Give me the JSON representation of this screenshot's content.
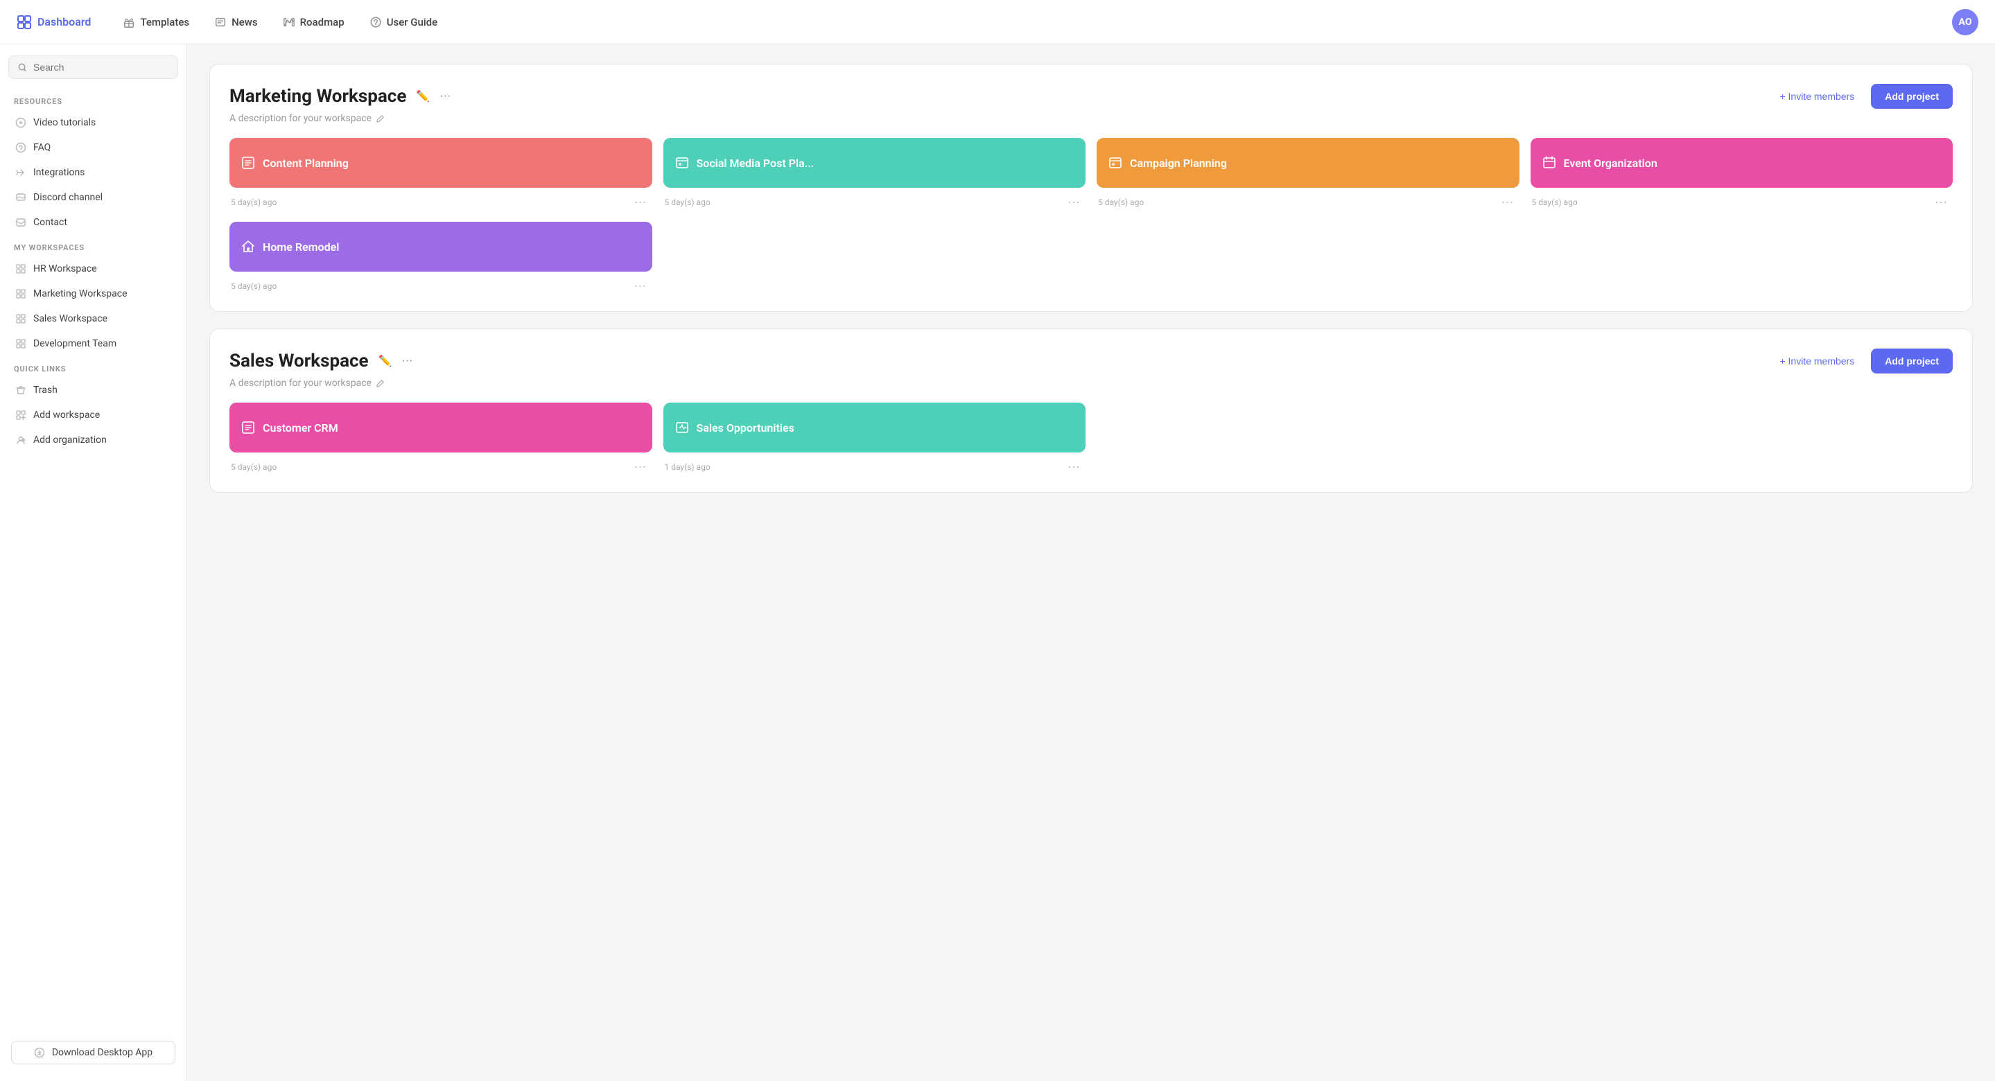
{
  "nav": {
    "logo_text": "Dashboard",
    "items": [
      {
        "label": "Templates",
        "icon": "gift-icon"
      },
      {
        "label": "News",
        "icon": "news-icon"
      },
      {
        "label": "Roadmap",
        "icon": "roadmap-icon"
      },
      {
        "label": "User Guide",
        "icon": "help-icon"
      }
    ],
    "avatar_initials": "AO"
  },
  "sidebar": {
    "search_placeholder": "Search",
    "sections": [
      {
        "label": "RESOURCES",
        "items": [
          {
            "label": "Video tutorials",
            "icon": "video-icon"
          },
          {
            "label": "FAQ",
            "icon": "faq-icon"
          },
          {
            "label": "Integrations",
            "icon": "integrations-icon"
          },
          {
            "label": "Discord channel",
            "icon": "discord-icon"
          },
          {
            "label": "Contact",
            "icon": "contact-icon"
          }
        ]
      },
      {
        "label": "MY WORKSPACES",
        "items": [
          {
            "label": "HR Workspace",
            "icon": "workspace-icon"
          },
          {
            "label": "Marketing Workspace",
            "icon": "workspace-icon"
          },
          {
            "label": "Sales Workspace",
            "icon": "workspace-icon"
          },
          {
            "label": "Development Team",
            "icon": "workspace-icon"
          }
        ]
      },
      {
        "label": "QUICK LINKS",
        "items": [
          {
            "label": "Trash",
            "icon": "trash-icon"
          },
          {
            "label": "Add workspace",
            "icon": "add-workspace-icon"
          },
          {
            "label": "Add organization",
            "icon": "add-org-icon"
          }
        ]
      }
    ],
    "download_label": "Download Desktop App"
  },
  "workspaces": [
    {
      "id": "marketing",
      "title": "Marketing Workspace",
      "description": "A description for your workspace",
      "invite_label": "+ Invite members",
      "add_project_label": "Add project",
      "projects": [
        {
          "name": "Content Planning",
          "color": "salmon",
          "time": "5 day(s) ago"
        },
        {
          "name": "Social Media Post Pla...",
          "color": "teal",
          "time": "5 day(s) ago"
        },
        {
          "name": "Campaign Planning",
          "color": "orange",
          "time": "5 day(s) ago"
        },
        {
          "name": "Event Organization",
          "color": "pink",
          "time": "5 day(s) ago"
        },
        {
          "name": "Home Remodel",
          "color": "purple",
          "time": "5 day(s) ago"
        }
      ]
    },
    {
      "id": "sales",
      "title": "Sales Workspace",
      "description": "A description for your workspace",
      "invite_label": "+ Invite members",
      "add_project_label": "Add project",
      "projects": [
        {
          "name": "Customer CRM",
          "color": "magenta",
          "time": "5 day(s) ago"
        },
        {
          "name": "Sales Opportunities",
          "color": "cyan",
          "time": "1 day(s) ago"
        }
      ]
    }
  ]
}
